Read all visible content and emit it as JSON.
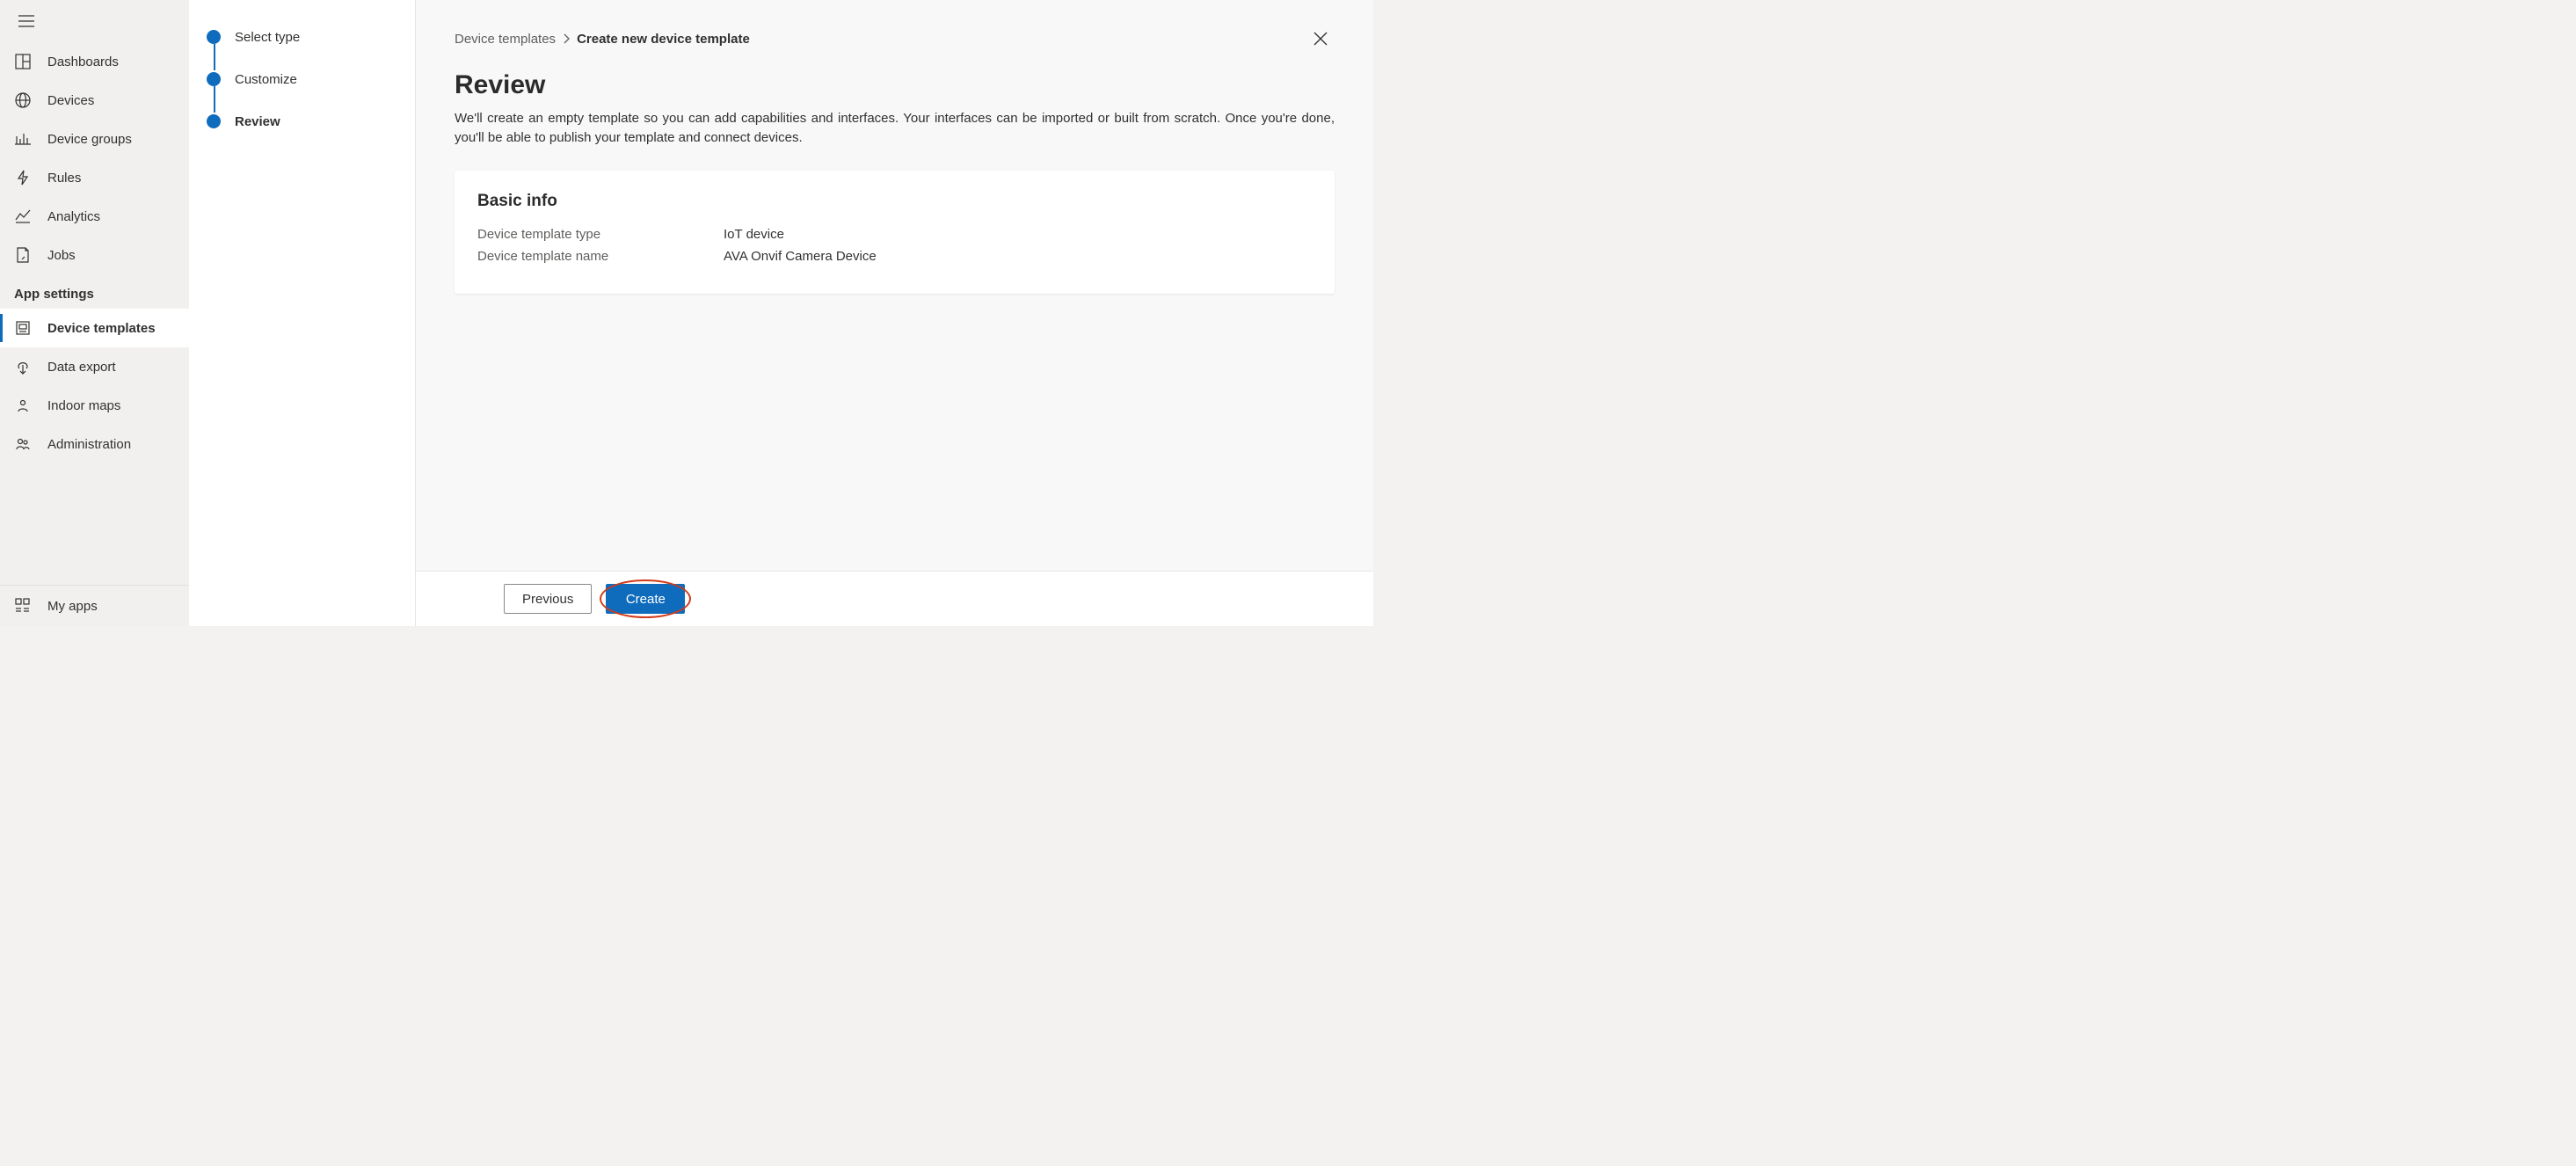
{
  "sidebar": {
    "items": [
      {
        "label": "Dashboards",
        "icon": "dashboard-icon",
        "active": false
      },
      {
        "label": "Devices",
        "icon": "devices-icon",
        "active": false
      },
      {
        "label": "Device groups",
        "icon": "device-groups-icon",
        "active": false
      },
      {
        "label": "Rules",
        "icon": "rules-icon",
        "active": false
      },
      {
        "label": "Analytics",
        "icon": "analytics-icon",
        "active": false
      },
      {
        "label": "Jobs",
        "icon": "jobs-icon",
        "active": false
      }
    ],
    "section_title": "App settings",
    "settings_items": [
      {
        "label": "Device templates",
        "icon": "device-templates-icon",
        "active": true
      },
      {
        "label": "Data export",
        "icon": "data-export-icon",
        "active": false
      },
      {
        "label": "Indoor maps",
        "icon": "indoor-maps-icon",
        "active": false
      },
      {
        "label": "Administration",
        "icon": "administration-icon",
        "active": false
      }
    ],
    "bottom_item": {
      "label": "My apps",
      "icon": "my-apps-icon"
    }
  },
  "stepper": {
    "steps": [
      {
        "label": "Select type",
        "current": false
      },
      {
        "label": "Customize",
        "current": false
      },
      {
        "label": "Review",
        "current": true
      }
    ]
  },
  "breadcrumb": {
    "parent": "Device templates",
    "current": "Create new device template"
  },
  "page": {
    "title": "Review",
    "description": "We'll create an empty template so you can add capabilities and interfaces. Your interfaces can be imported or built from scratch. Once you're done, you'll be able to publish your template and connect devices."
  },
  "card": {
    "title": "Basic info",
    "rows": [
      {
        "label": "Device template type",
        "value": "IoT device"
      },
      {
        "label": "Device template name",
        "value": "AVA Onvif Camera Device"
      }
    ]
  },
  "footer": {
    "previous": "Previous",
    "create": "Create"
  }
}
